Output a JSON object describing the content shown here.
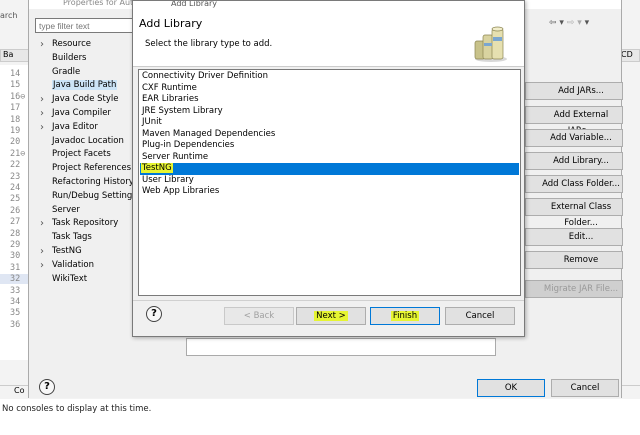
{
  "ide": {
    "search_text": "arch",
    "tab_label": "Ba",
    "right_tab_label": "CD",
    "line_numbers": [
      "14",
      "15",
      "16",
      "17",
      "18",
      "19",
      "20",
      "21",
      "22",
      "23",
      "24",
      "25",
      "26",
      "27",
      "28",
      "29",
      "30",
      "31",
      "32",
      "33",
      "34",
      "35",
      "36"
    ],
    "line_markers": {
      "16": "16⊖",
      "21": "21⊖"
    },
    "console_tab": "Co",
    "console_text": "No consoles to display at this time."
  },
  "properties": {
    "title": "Properties for Autom",
    "filter_placeholder": "type filter text",
    "tree": [
      {
        "label": "Resource",
        "expandable": true
      },
      {
        "label": "Builders",
        "expandable": false
      },
      {
        "label": "Gradle",
        "expandable": false
      },
      {
        "label": "Java Build Path",
        "expandable": false,
        "selected": true
      },
      {
        "label": "Java Code Style",
        "expandable": true
      },
      {
        "label": "Java Compiler",
        "expandable": true
      },
      {
        "label": "Java Editor",
        "expandable": true
      },
      {
        "label": "Javadoc Location",
        "expandable": false
      },
      {
        "label": "Project Facets",
        "expandable": false
      },
      {
        "label": "Project References",
        "expandable": false
      },
      {
        "label": "Refactoring History",
        "expandable": false
      },
      {
        "label": "Run/Debug Settings",
        "expandable": false
      },
      {
        "label": "Server",
        "expandable": false
      },
      {
        "label": "Task Repository",
        "expandable": true
      },
      {
        "label": "Task Tags",
        "expandable": false
      },
      {
        "label": "TestNG",
        "expandable": true
      },
      {
        "label": "Validation",
        "expandable": true
      },
      {
        "label": "WikiText",
        "expandable": false
      }
    ],
    "buttons": {
      "add_jars": "Add JARs...",
      "add_external_jars": "Add External JARs...",
      "add_variable": "Add Variable...",
      "add_library": "Add Library...",
      "add_class_folder": "Add Class Folder...",
      "add_external_class_folder": "External Class Folder...",
      "edit": "Edit...",
      "remove": "Remove",
      "migrate_jar": "Migrate JAR File..."
    },
    "help": "?",
    "ok": "OK",
    "cancel": "Cancel"
  },
  "add_library": {
    "window_title": "Add Library",
    "header_title": "Add Library",
    "header_desc": "Select the library type to add.",
    "items": [
      "Connectivity Driver Definition",
      "CXF Runtime",
      "EAR Libraries",
      "JRE System Library",
      "JUnit",
      "Maven Managed Dependencies",
      "Plug-in Dependencies",
      "Server Runtime",
      "TestNG",
      "User Library",
      "Web App Libraries"
    ],
    "selected_index": 8,
    "help": "?",
    "back": "< Back",
    "next": "Next >",
    "finish": "Finish",
    "cancel": "Cancel"
  },
  "colors": {
    "selection": "#0078d7",
    "highlight": "#e6f532",
    "tree_selection": "#cce4f7"
  }
}
